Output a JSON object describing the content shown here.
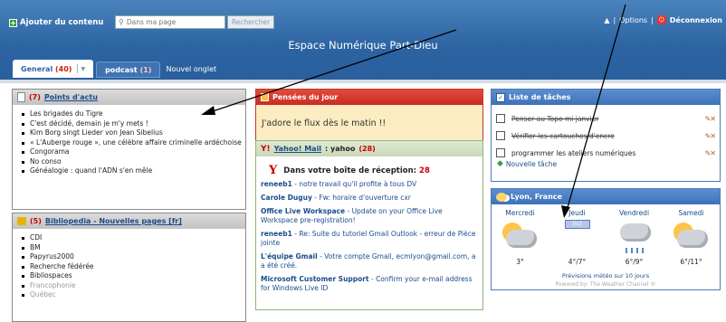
{
  "header": {
    "add_content": "Ajouter du contenu",
    "search_placeholder": "Dans ma page",
    "search_button": "Rechercher",
    "options": "Options",
    "logout": "Déconnexion",
    "site_title": "Espace Numérique Part-Dieu"
  },
  "tabs": [
    {
      "label": "General",
      "count": "(40)"
    },
    {
      "label": "podcast",
      "count": "(1)"
    },
    {
      "label": "Nouvel onglet"
    }
  ],
  "points_actu": {
    "count": "(7)",
    "title": "Points d'actu",
    "items": [
      "Les brigades du Tigre",
      "C'est décidé, demain je m'y mets !",
      "Kim Borg singt Lieder von Jean Sibelius",
      "« L'Auberge rouge », une célèbre affaire criminelle ardéchoise",
      "Congorama",
      "No conso",
      "Généalogie : quand l'ADN s'en mêle"
    ]
  },
  "bibliopedia": {
    "count": "(5)",
    "title": "Bibliopedia - Nouvelles pages [fr]",
    "items": [
      "CDI",
      "BM",
      "Papyrus2000",
      "Recherche fédérée",
      "Bibliospaces",
      "Francophonie",
      "Québec"
    ]
  },
  "pensees": {
    "title": "Pensées du jour",
    "text": "J'adore le flux dès le matin !!"
  },
  "mail": {
    "title": "Yahoo! Mail",
    "user": ": yahoo",
    "count": "(28)",
    "inbox_label": "Dans votre boîte de réception:",
    "inbox_count": "28",
    "messages": [
      {
        "from": "reneeb1",
        "text": " - notre travail qu'il profite à tous DV"
      },
      {
        "from": "Carole Duguy",
        "text": " - Fw: horaire d'ouverture cxr"
      },
      {
        "from": "Office Live Workspace",
        "text": " - Update on your Office Live Workspace pre-registration!"
      },
      {
        "from": "reneeb1",
        "text": " - Re: Suite du tutoriel Gmail Outlook - erreur de Pièce jointe"
      },
      {
        "from": "L'équipe Gmail",
        "text": " - Votre compte Gmail, ecmlyon@gmail.com, a a été créé."
      },
      {
        "from": "Microsoft Customer Support",
        "text": " - Confirm your e-mail address for Windows Live ID"
      }
    ]
  },
  "tasks": {
    "title": "Liste de tâches",
    "items": [
      {
        "text": "Penser au Topo mi janvier",
        "done": true
      },
      {
        "text": "Vérifier les cartouches d'encre",
        "done": true
      },
      {
        "text": "programmer les ateliers numériques",
        "done": false
      }
    ],
    "new_task": "Nouvelle tâche"
  },
  "weather": {
    "title": "Lyon, France",
    "days": [
      {
        "day": "Mercredi",
        "temp": "3°",
        "icon": "sun-cloud-icon"
      },
      {
        "day": "Jeudi",
        "temp": "4°/7°",
        "icon": "cloud-icon",
        "badge": "[ic]"
      },
      {
        "day": "Vendredi",
        "temp": "6°/9°",
        "icon": "rain-cloud-icon"
      },
      {
        "day": "Samedi",
        "temp": "6°/11°",
        "icon": "sun-cloud-icon"
      }
    ],
    "forecast_link": "Prévisions météo sur 10 jours",
    "powered": "Powered by: The Weather Channel ®"
  }
}
